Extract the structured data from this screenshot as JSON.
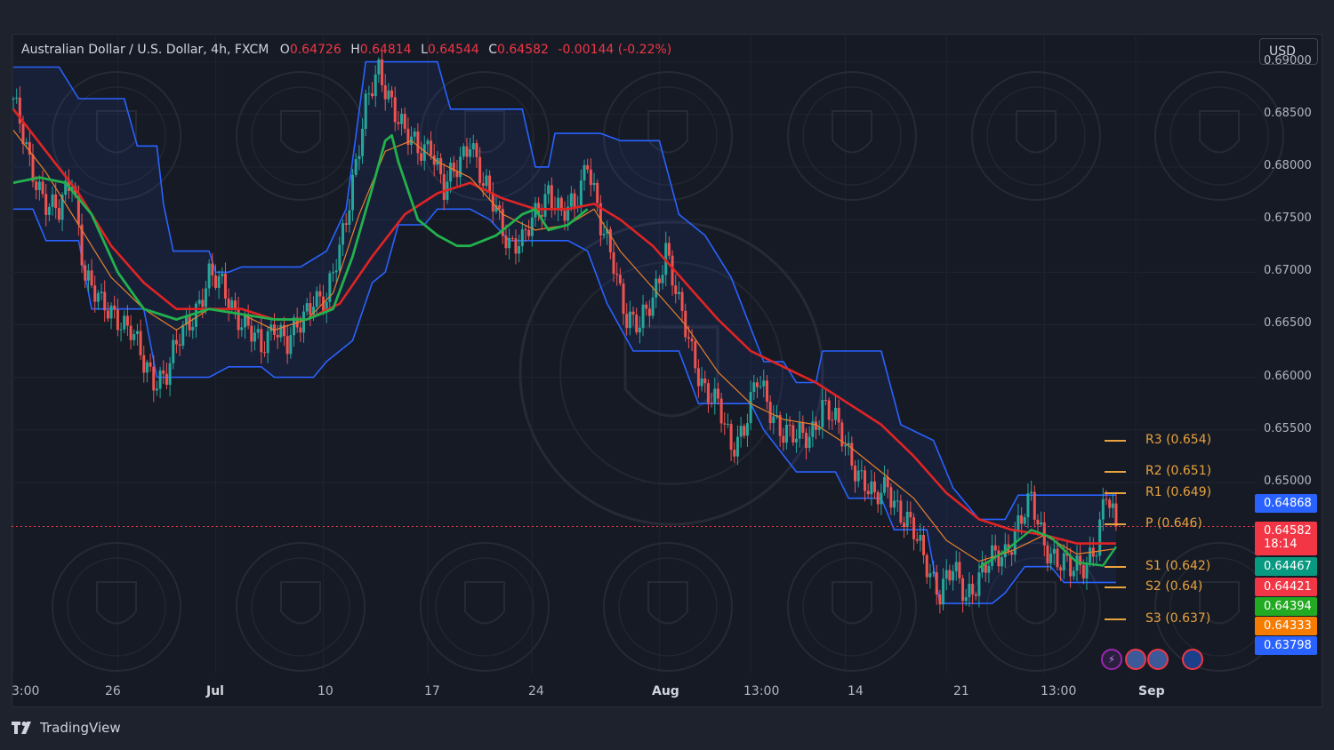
{
  "header": {
    "symbol": "Australian Dollar / U.S. Dollar, 4h, FXCM",
    "open_label": "O",
    "open": "0.64726",
    "high_label": "H",
    "high": "0.64814",
    "low_label": "L",
    "low": "0.64544",
    "close_label": "C",
    "close": "0.64582",
    "change": "-0.00144 (-0.22%)"
  },
  "currency_button": "USD",
  "brand": "TradingView",
  "colors": {
    "background": "#161a25",
    "up": "#26a69a",
    "down": "#ef5350",
    "channel": "#2962ff",
    "pivot": "#e8a33d",
    "ema_green": "#22b14c",
    "ema_red": "#e02424"
  },
  "price_tags": [
    {
      "value": "0.64868",
      "color": "#2962ff"
    },
    {
      "value": "0.64582",
      "sub": "18:14",
      "color": "#f23645"
    },
    {
      "value": "0.64467",
      "color": "#089981"
    },
    {
      "value": "0.64421",
      "color": "#f23645"
    },
    {
      "value": "0.64394",
      "color": "#22ab22"
    },
    {
      "value": "0.64333",
      "color": "#f57c00"
    },
    {
      "value": "0.63798",
      "color": "#2962ff"
    }
  ],
  "event_icons": [
    "lightning-icon",
    "us-flag-icon",
    "us-flag-icon",
    "australia-flag-icon"
  ],
  "chart_data": {
    "type": "candlestick",
    "title": "Australian Dollar / U.S. Dollar, 4h, FXCM",
    "ylim": [
      0.632,
      0.6925
    ],
    "y_ticks": [
      "0.69000",
      "0.68500",
      "0.68000",
      "0.67500",
      "0.67000",
      "0.66500",
      "0.66000",
      "0.65500",
      "0.65000"
    ],
    "x_ticks": [
      {
        "label": "3:00",
        "bold": false
      },
      {
        "label": "26",
        "bold": false
      },
      {
        "label": "Jul",
        "bold": true
      },
      {
        "label": "10",
        "bold": false
      },
      {
        "label": "17",
        "bold": false
      },
      {
        "label": "24",
        "bold": false
      },
      {
        "label": "Aug",
        "bold": true
      },
      {
        "label": "13:00",
        "bold": false
      },
      {
        "label": "14",
        "bold": false
      },
      {
        "label": "21",
        "bold": false
      },
      {
        "label": "13:00",
        "bold": false
      },
      {
        "label": "Sep",
        "bold": true
      }
    ],
    "close_path": [
      [
        0,
        0.6865
      ],
      [
        5,
        0.68
      ],
      [
        10,
        0.677
      ],
      [
        14,
        0.6755
      ],
      [
        18,
        0.679
      ],
      [
        22,
        0.67
      ],
      [
        27,
        0.6665
      ],
      [
        32,
        0.666
      ],
      [
        36,
        0.6645
      ],
      [
        40,
        0.661
      ],
      [
        43,
        0.66
      ],
      [
        47,
        0.6605
      ],
      [
        51,
        0.6635
      ],
      [
        55,
        0.666
      ],
      [
        60,
        0.6695
      ],
      [
        64,
        0.6685
      ],
      [
        68,
        0.6665
      ],
      [
        72,
        0.6645
      ],
      [
        76,
        0.6625
      ],
      [
        80,
        0.6655
      ],
      [
        84,
        0.663
      ],
      [
        88,
        0.665
      ],
      [
        92,
        0.668
      ],
      [
        96,
        0.667
      ],
      [
        100,
        0.672
      ],
      [
        104,
        0.679
      ],
      [
        108,
        0.6855
      ],
      [
        112,
        0.689
      ],
      [
        116,
        0.6865
      ],
      [
        120,
        0.683
      ],
      [
        124,
        0.6815
      ],
      [
        128,
        0.6825
      ],
      [
        132,
        0.6775
      ],
      [
        136,
        0.68
      ],
      [
        140,
        0.683
      ],
      [
        144,
        0.678
      ],
      [
        148,
        0.676
      ],
      [
        152,
        0.673
      ],
      [
        156,
        0.6725
      ],
      [
        160,
        0.6755
      ],
      [
        164,
        0.678
      ],
      [
        168,
        0.675
      ],
      [
        172,
        0.6765
      ],
      [
        176,
        0.681
      ],
      [
        180,
        0.674
      ],
      [
        184,
        0.671
      ],
      [
        188,
        0.666
      ],
      [
        192,
        0.6645
      ],
      [
        196,
        0.6675
      ],
      [
        200,
        0.6725
      ],
      [
        204,
        0.6665
      ],
      [
        208,
        0.6625
      ],
      [
        212,
        0.659
      ],
      [
        216,
        0.657
      ],
      [
        220,
        0.6535
      ],
      [
        224,
        0.6555
      ],
      [
        228,
        0.6595
      ],
      [
        232,
        0.657
      ],
      [
        236,
        0.655
      ],
      [
        240,
        0.654
      ],
      [
        244,
        0.6545
      ],
      [
        248,
        0.6575
      ],
      [
        252,
        0.6555
      ],
      [
        256,
        0.653
      ],
      [
        260,
        0.6505
      ],
      [
        264,
        0.648
      ],
      [
        268,
        0.65
      ],
      [
        272,
        0.647
      ],
      [
        276,
        0.645
      ],
      [
        280,
        0.6425
      ],
      [
        284,
        0.6395
      ],
      [
        288,
        0.6415
      ],
      [
        292,
        0.6395
      ],
      [
        296,
        0.641
      ],
      [
        300,
        0.6425
      ],
      [
        304,
        0.6435
      ],
      [
        308,
        0.646
      ],
      [
        312,
        0.648
      ],
      [
        316,
        0.6445
      ],
      [
        320,
        0.6425
      ],
      [
        324,
        0.6415
      ],
      [
        328,
        0.6425
      ],
      [
        332,
        0.644
      ],
      [
        335,
        0.6486
      ],
      [
        338,
        0.64582
      ]
    ],
    "channel_upper": [
      [
        0,
        0.6895
      ],
      [
        14,
        0.6895
      ],
      [
        20,
        0.6865
      ],
      [
        34,
        0.6865
      ],
      [
        38,
        0.682
      ],
      [
        44,
        0.682
      ],
      [
        46,
        0.6765
      ],
      [
        49,
        0.672
      ],
      [
        60,
        0.672
      ],
      [
        62,
        0.67
      ],
      [
        66,
        0.67
      ],
      [
        70,
        0.6705
      ],
      [
        88,
        0.6705
      ],
      [
        96,
        0.672
      ],
      [
        102,
        0.676
      ],
      [
        108,
        0.69
      ],
      [
        130,
        0.69
      ],
      [
        134,
        0.6855
      ],
      [
        142,
        0.6855
      ],
      [
        148,
        0.6855
      ],
      [
        156,
        0.6855
      ],
      [
        160,
        0.68
      ],
      [
        164,
        0.68
      ],
      [
        166,
        0.6832
      ],
      [
        180,
        0.6832
      ],
      [
        186,
        0.6825
      ],
      [
        198,
        0.6825
      ],
      [
        204,
        0.6755
      ],
      [
        212,
        0.6735
      ],
      [
        220,
        0.6695
      ],
      [
        230,
        0.6615
      ],
      [
        236,
        0.6615
      ],
      [
        240,
        0.6595
      ],
      [
        246,
        0.6595
      ],
      [
        248,
        0.6625
      ],
      [
        266,
        0.6625
      ],
      [
        272,
        0.6555
      ],
      [
        282,
        0.654
      ],
      [
        288,
        0.6495
      ],
      [
        296,
        0.6465
      ],
      [
        304,
        0.6465
      ],
      [
        308,
        0.6488
      ],
      [
        328,
        0.6488
      ],
      [
        338,
        0.6488
      ]
    ],
    "channel_lower": [
      [
        0,
        0.676
      ],
      [
        6,
        0.676
      ],
      [
        10,
        0.673
      ],
      [
        20,
        0.673
      ],
      [
        24,
        0.6665
      ],
      [
        40,
        0.6665
      ],
      [
        44,
        0.66
      ],
      [
        60,
        0.66
      ],
      [
        66,
        0.661
      ],
      [
        76,
        0.661
      ],
      [
        80,
        0.66
      ],
      [
        92,
        0.66
      ],
      [
        96,
        0.6615
      ],
      [
        104,
        0.6635
      ],
      [
        110,
        0.669
      ],
      [
        114,
        0.67
      ],
      [
        118,
        0.6745
      ],
      [
        126,
        0.6745
      ],
      [
        130,
        0.676
      ],
      [
        140,
        0.676
      ],
      [
        146,
        0.675
      ],
      [
        152,
        0.673
      ],
      [
        170,
        0.673
      ],
      [
        176,
        0.672
      ],
      [
        182,
        0.667
      ],
      [
        190,
        0.6625
      ],
      [
        204,
        0.6625
      ],
      [
        210,
        0.6575
      ],
      [
        226,
        0.6575
      ],
      [
        230,
        0.655
      ],
      [
        240,
        0.651
      ],
      [
        252,
        0.651
      ],
      [
        256,
        0.6485
      ],
      [
        266,
        0.6485
      ],
      [
        270,
        0.6455
      ],
      [
        280,
        0.6455
      ],
      [
        284,
        0.6385
      ],
      [
        300,
        0.6385
      ],
      [
        304,
        0.6395
      ],
      [
        310,
        0.642
      ],
      [
        318,
        0.642
      ],
      [
        322,
        0.6405
      ],
      [
        338,
        0.6405
      ]
    ],
    "ema_fast": [
      [
        0,
        0.6835
      ],
      [
        10,
        0.6795
      ],
      [
        20,
        0.6745
      ],
      [
        30,
        0.6695
      ],
      [
        40,
        0.6665
      ],
      [
        50,
        0.6645
      ],
      [
        60,
        0.6665
      ],
      [
        70,
        0.666
      ],
      [
        80,
        0.6645
      ],
      [
        90,
        0.6655
      ],
      [
        98,
        0.668
      ],
      [
        106,
        0.6755
      ],
      [
        114,
        0.6815
      ],
      [
        122,
        0.6825
      ],
      [
        130,
        0.6805
      ],
      [
        140,
        0.679
      ],
      [
        150,
        0.6755
      ],
      [
        160,
        0.674
      ],
      [
        170,
        0.6745
      ],
      [
        178,
        0.676
      ],
      [
        186,
        0.672
      ],
      [
        196,
        0.6685
      ],
      [
        206,
        0.665
      ],
      [
        216,
        0.6605
      ],
      [
        226,
        0.6575
      ],
      [
        236,
        0.656
      ],
      [
        246,
        0.6555
      ],
      [
        256,
        0.6535
      ],
      [
        266,
        0.651
      ],
      [
        276,
        0.6485
      ],
      [
        286,
        0.6445
      ],
      [
        296,
        0.6425
      ],
      [
        306,
        0.6435
      ],
      [
        316,
        0.645
      ],
      [
        326,
        0.6432
      ],
      [
        338,
        0.6437
      ]
    ],
    "ema_slow": [
      [
        0,
        0.6855
      ],
      [
        10,
        0.6815
      ],
      [
        20,
        0.6775
      ],
      [
        30,
        0.6725
      ],
      [
        40,
        0.669
      ],
      [
        50,
        0.6665
      ],
      [
        60,
        0.6665
      ],
      [
        70,
        0.6665
      ],
      [
        80,
        0.6655
      ],
      [
        90,
        0.6655
      ],
      [
        100,
        0.667
      ],
      [
        110,
        0.6715
      ],
      [
        120,
        0.6755
      ],
      [
        130,
        0.6775
      ],
      [
        140,
        0.6785
      ],
      [
        150,
        0.677
      ],
      [
        160,
        0.676
      ],
      [
        170,
        0.676
      ],
      [
        178,
        0.6765
      ],
      [
        186,
        0.675
      ],
      [
        196,
        0.6725
      ],
      [
        206,
        0.669
      ],
      [
        216,
        0.6655
      ],
      [
        226,
        0.6625
      ],
      [
        236,
        0.661
      ],
      [
        246,
        0.6595
      ],
      [
        256,
        0.6575
      ],
      [
        266,
        0.6555
      ],
      [
        276,
        0.6525
      ],
      [
        286,
        0.649
      ],
      [
        296,
        0.6465
      ],
      [
        306,
        0.6455
      ],
      [
        316,
        0.645
      ],
      [
        326,
        0.6442
      ],
      [
        338,
        0.6442
      ]
    ],
    "ema_green": [
      [
        0,
        0.6785
      ],
      [
        8,
        0.679
      ],
      [
        16,
        0.6785
      ],
      [
        24,
        0.6755
      ],
      [
        32,
        0.67
      ],
      [
        40,
        0.6665
      ],
      [
        50,
        0.6655
      ],
      [
        60,
        0.6665
      ],
      [
        70,
        0.666
      ],
      [
        80,
        0.6655
      ],
      [
        90,
        0.6655
      ],
      [
        98,
        0.6665
      ],
      [
        104,
        0.6715
      ],
      [
        110,
        0.678
      ],
      [
        114,
        0.6825
      ],
      [
        116,
        0.683
      ],
      [
        118,
        0.6805
      ],
      [
        124,
        0.675
      ],
      [
        130,
        0.6735
      ],
      [
        136,
        0.6725
      ],
      [
        140,
        0.6725
      ],
      [
        148,
        0.6735
      ],
      [
        156,
        0.6755
      ],
      [
        160,
        0.676
      ],
      [
        164,
        0.674
      ],
      [
        170,
        0.6745
      ],
      [
        176,
        0.676
      ],
      [
        296,
        0.6419
      ],
      [
        304,
        0.6435
      ],
      [
        312,
        0.6455
      ],
      [
        318,
        0.6448
      ],
      [
        326,
        0.6424
      ],
      [
        334,
        0.6421
      ],
      [
        338,
        0.6439
      ]
    ],
    "pivots": [
      {
        "label": "R3 (0.654)",
        "value": 0.654
      },
      {
        "label": "R2 (0.651)",
        "value": 0.651
      },
      {
        "label": "R1 (0.649)",
        "value": 0.649
      },
      {
        "label": "P (0.646)",
        "value": 0.646
      },
      {
        "label": "S1 (0.642)",
        "value": 0.642
      },
      {
        "label": "S2 (0.64)",
        "value": 0.64
      },
      {
        "label": "S3 (0.637)",
        "value": 0.637
      }
    ],
    "last_price": 0.64582
  }
}
